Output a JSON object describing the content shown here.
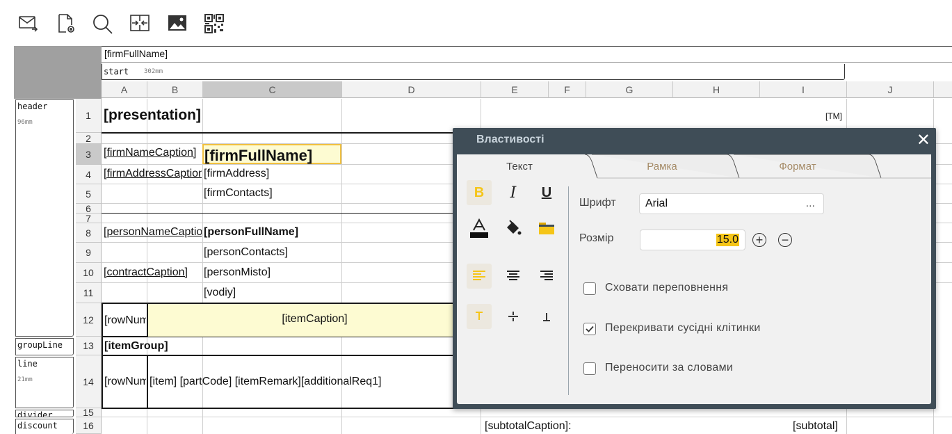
{
  "toolbar": {
    "icons": [
      "mail-send-icon",
      "document-settings-icon",
      "search-icon",
      "merge-columns-icon",
      "image-icon",
      "qr-code-icon"
    ]
  },
  "sheet": {
    "top_field": "[firmFullName]",
    "start_band": {
      "name": "start",
      "size": "302mm"
    },
    "columns": [
      "A",
      "B",
      "C",
      "D",
      "E",
      "F",
      "G",
      "H",
      "I",
      "J"
    ],
    "selected_column": "C",
    "rows": [
      "1",
      "2",
      "3",
      "4",
      "5",
      "6",
      "7",
      "8",
      "9",
      "10",
      "11",
      "12",
      "13",
      "14",
      "15",
      "16"
    ],
    "selected_row": "3",
    "bands": [
      {
        "name": "header",
        "size": "96mm"
      },
      {
        "name": "groupLine",
        "size": ""
      },
      {
        "name": "line",
        "size": "21mm"
      },
      {
        "name": "divider",
        "size": ""
      },
      {
        "name": "discount",
        "size": ""
      }
    ],
    "cells": {
      "presentation": "[presentation]",
      "tm": "[TM]",
      "firm_name_caption": "[firmNameCaption]",
      "firm_full_name": "[firmFullName]",
      "firm_address_caption": "[firmAddressCaption]",
      "firm_address": "[firmAddress]",
      "firm_contacts": "[firmContacts]",
      "person_name_caption": "[personNameCaption]",
      "person_full_name": "[personFullName]",
      "person_contacts": "[personContacts]",
      "contract_caption": "[contractCaption]",
      "person_misto": "[personMisto]",
      "vodiy": "[vodiy]",
      "row_num_12": "[rowNum]",
      "item_caption": "[itemCaption]",
      "item_group": "[itemGroup]",
      "row_num_14": "[rowNum]",
      "item_line": "[item] [partCode] [itemRemark][additionalReq1]",
      "subtotal_caption": "[subtotalCaption]:",
      "subtotal": "[subtotal]"
    }
  },
  "dialog": {
    "title": "Властивості",
    "tabs": [
      "Текст",
      "Рамка",
      "Формат"
    ],
    "active_tab": "Текст",
    "font_label": "Шрифт",
    "font_value": "Arial",
    "font_more": "...",
    "size_label": "Розмір",
    "size_value": "15.0",
    "checkboxes": [
      {
        "label": "Сховати переповнення",
        "checked": false
      },
      {
        "label": "Перекривати сусідні клітинки",
        "checked": true
      },
      {
        "label": "Переносити за словами",
        "checked": false
      }
    ],
    "bold_active": true,
    "align_left_active": true,
    "valign_top_active": true,
    "accent_color": "#f5c518"
  }
}
